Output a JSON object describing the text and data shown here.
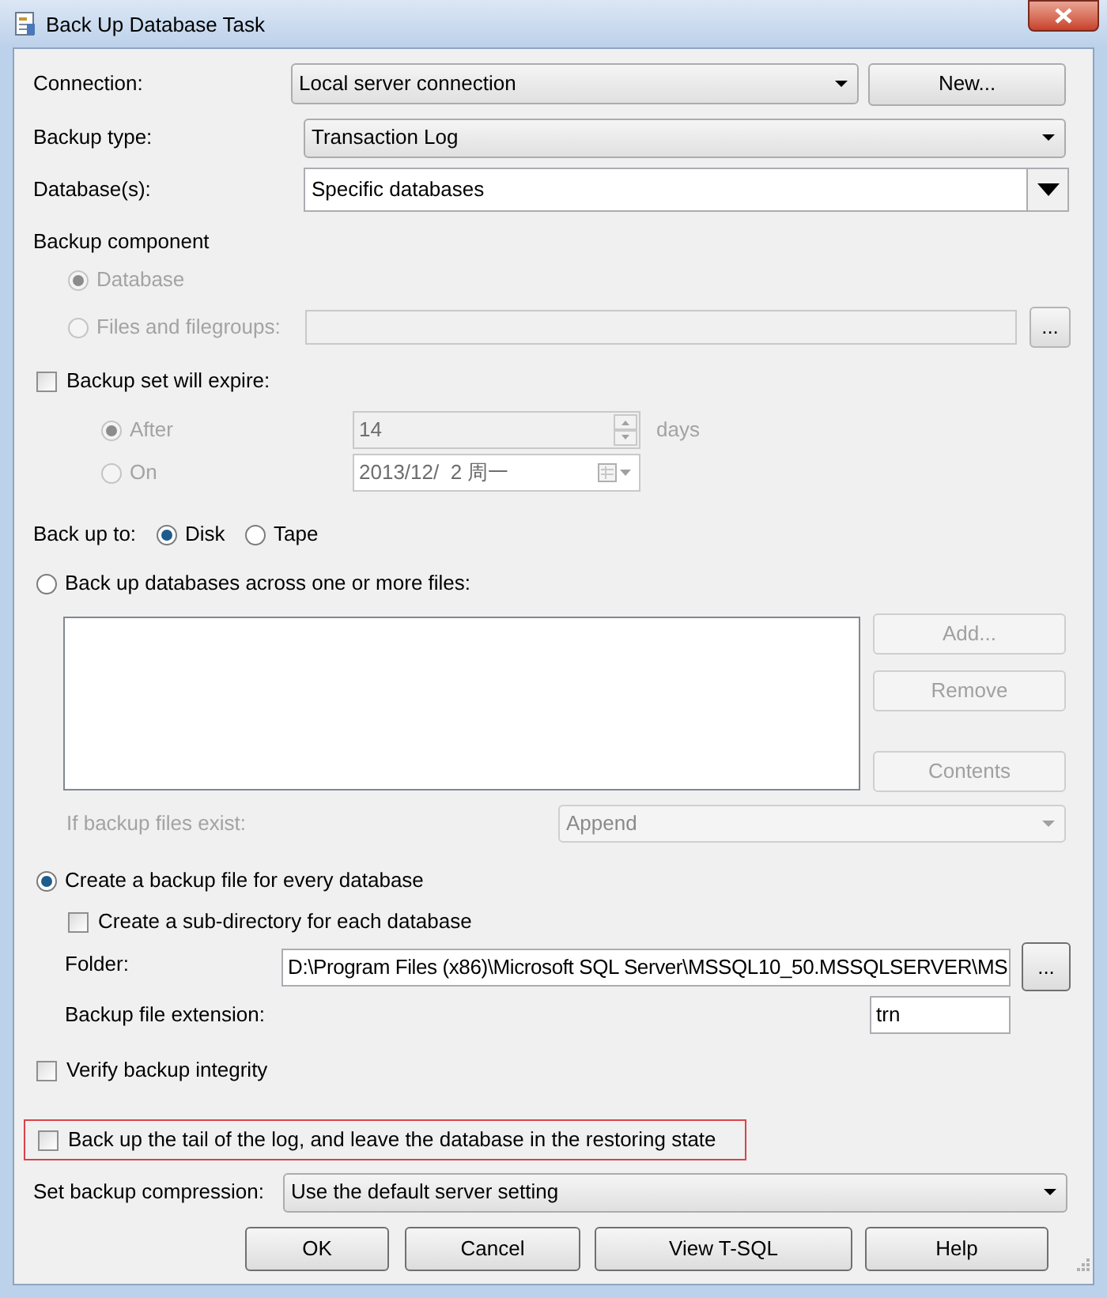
{
  "window": {
    "title": "Back Up Database Task"
  },
  "connection": {
    "label": "Connection:",
    "value": "Local server connection",
    "button": "New..."
  },
  "backup_type": {
    "label": "Backup type:",
    "value": "Transaction Log"
  },
  "databases": {
    "label": "Database(s):",
    "value": "Specific databases"
  },
  "backup_component": {
    "label": "Backup component",
    "options": [
      {
        "label": "Database",
        "selected": true,
        "disabled": true
      },
      {
        "label": "Files and filegroups:",
        "selected": false,
        "disabled": true
      }
    ],
    "browse_button": "..."
  },
  "expire": {
    "label": "Backup set will expire:",
    "checked": false,
    "options": [
      {
        "label": "After",
        "selected": true,
        "disabled": true,
        "value": "14",
        "unit": "days"
      },
      {
        "label": "On",
        "selected": false,
        "disabled": true,
        "value": "2013/12/  2 周一"
      }
    ]
  },
  "back_up_to": {
    "label": "Back up to:",
    "options": [
      {
        "label": "Disk",
        "selected": true
      },
      {
        "label": "Tape",
        "selected": false
      }
    ]
  },
  "across_files": {
    "label": "Back up databases across one or more files:",
    "selected": false,
    "buttons": [
      {
        "label": "Add...",
        "disabled": true
      },
      {
        "label": "Remove",
        "disabled": true
      },
      {
        "label": "Contents",
        "disabled": true
      }
    ],
    "if_exists": {
      "label": "If backup files exist:",
      "value": "Append",
      "disabled": true
    }
  },
  "per_database": {
    "label": "Create a backup file for every database",
    "selected": true,
    "subdirectory": {
      "label": "Create a sub-directory for each database",
      "checked": false
    },
    "folder": {
      "label": "Folder:",
      "value": "D:\\Program Files (x86)\\Microsoft SQL Server\\MSSQL10_50.MSSQLSERVER\\MS",
      "browse_button": "..."
    },
    "extension": {
      "label": "Backup file extension:",
      "value": "trn"
    }
  },
  "verify": {
    "label": "Verify backup integrity",
    "checked": false
  },
  "tail_log": {
    "label": "Back up the tail of the log, and leave the database in the restoring state",
    "checked": false,
    "highlighted": true
  },
  "compression": {
    "label": "Set backup compression:",
    "value": "Use the default server setting"
  },
  "buttons": [
    "OK",
    "Cancel",
    "View T-SQL",
    "Help"
  ]
}
